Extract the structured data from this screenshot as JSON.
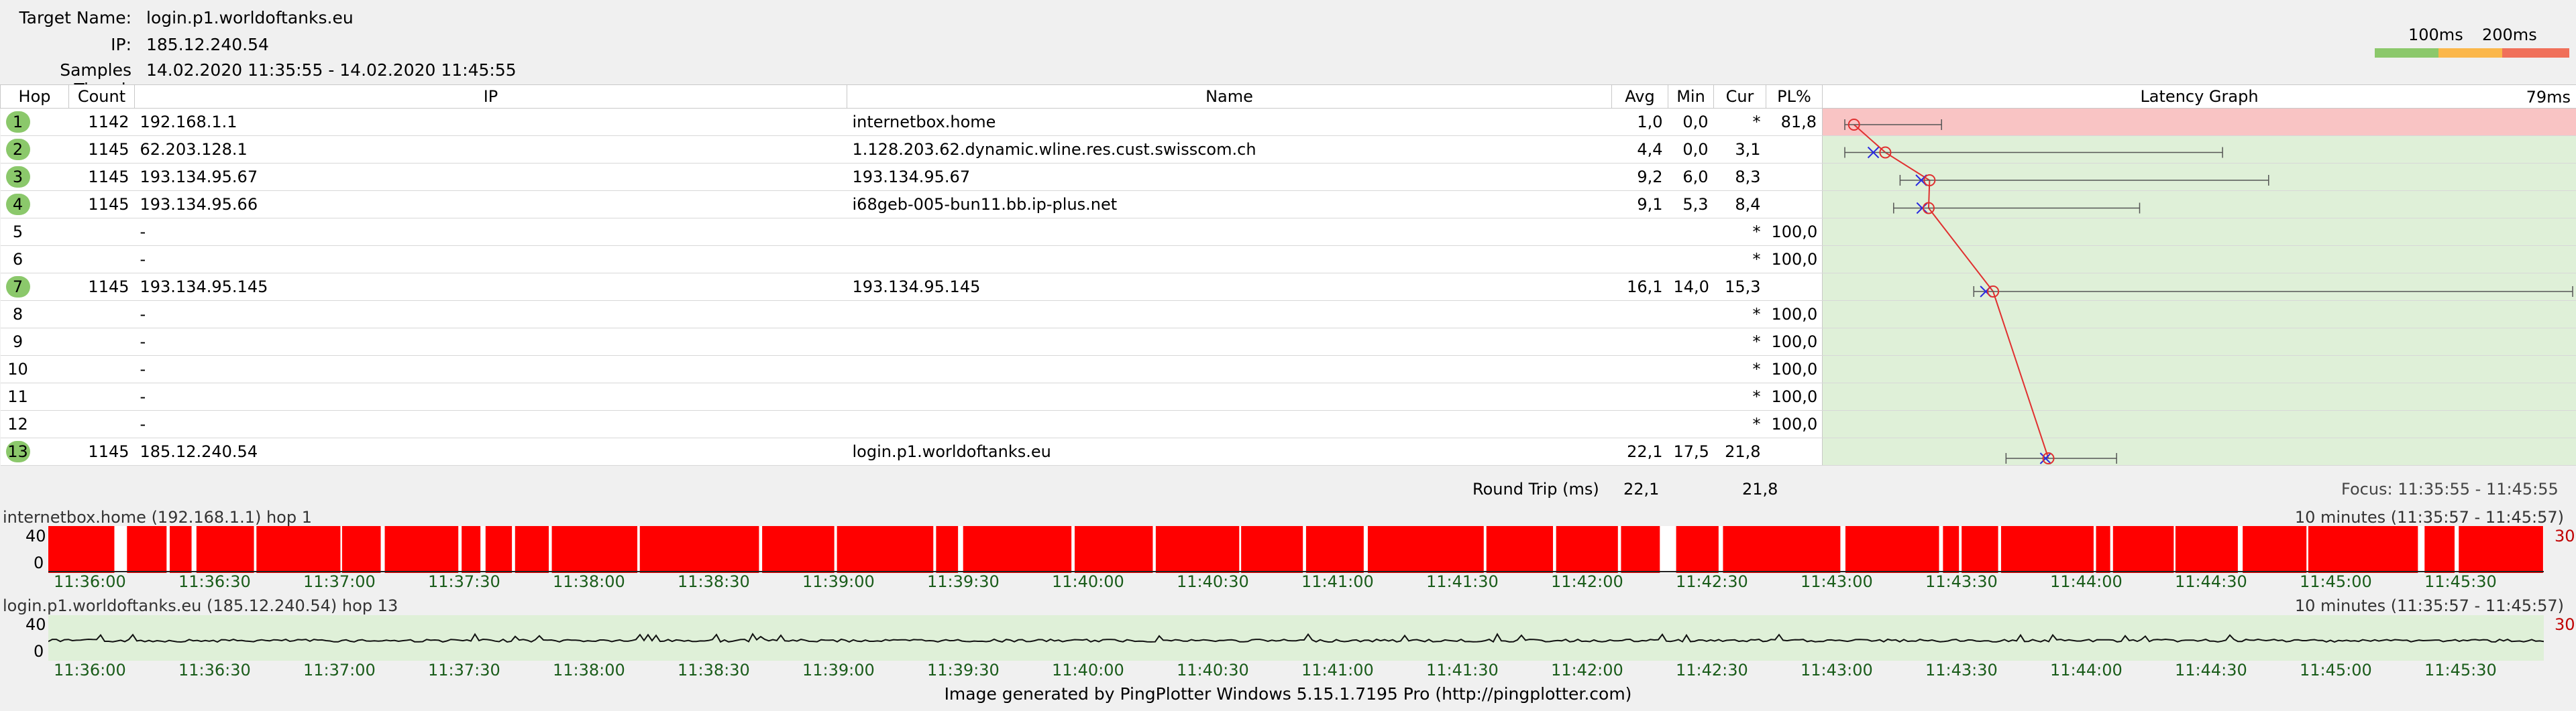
{
  "header": {
    "target_label": "Target Name:",
    "target_value": "login.p1.worldoftanks.eu",
    "ip_label": "IP:",
    "ip_value": "185.12.240.54",
    "samples_label": "Samples Timed:",
    "samples_value": "14.02.2020 11:35:55 - 14.02.2020 11:45:55"
  },
  "legend": {
    "label_100": "100ms",
    "label_200": "200ms",
    "colors": [
      "#8bc86b",
      "#fbb74a",
      "#f0705a"
    ]
  },
  "table": {
    "columns": [
      "Hop",
      "Count",
      "IP",
      "Name",
      "Avg",
      "Min",
      "Cur",
      "PL%",
      "Latency Graph"
    ],
    "graph_scale_label": "79ms",
    "rows": [
      {
        "hop": "1",
        "count": "1142",
        "ip": "192.168.1.1",
        "name": "internetbox.home",
        "avg": "1,0",
        "min": "0,0",
        "cur": "*",
        "pl": "81,8",
        "ok": true
      },
      {
        "hop": "2",
        "count": "1145",
        "ip": "62.203.128.1",
        "name": "1.128.203.62.dynamic.wline.res.cust.swisscom.ch",
        "avg": "4,4",
        "min": "0,0",
        "cur": "3,1",
        "pl": "",
        "ok": true
      },
      {
        "hop": "3",
        "count": "1145",
        "ip": "193.134.95.67",
        "name": "193.134.95.67",
        "avg": "9,2",
        "min": "6,0",
        "cur": "8,3",
        "pl": "",
        "ok": true
      },
      {
        "hop": "4",
        "count": "1145",
        "ip": "193.134.95.66",
        "name": "i68geb-005-bun11.bb.ip-plus.net",
        "avg": "9,1",
        "min": "5,3",
        "cur": "8,4",
        "pl": "",
        "ok": true
      },
      {
        "hop": "5",
        "count": "",
        "ip": "-",
        "name": "",
        "avg": "",
        "min": "",
        "cur": "*",
        "pl": "100,0",
        "ok": false
      },
      {
        "hop": "6",
        "count": "",
        "ip": "-",
        "name": "",
        "avg": "",
        "min": "",
        "cur": "*",
        "pl": "100,0",
        "ok": false
      },
      {
        "hop": "7",
        "count": "1145",
        "ip": "193.134.95.145",
        "name": "193.134.95.145",
        "avg": "16,1",
        "min": "14,0",
        "cur": "15,3",
        "pl": "",
        "ok": true
      },
      {
        "hop": "8",
        "count": "",
        "ip": "-",
        "name": "",
        "avg": "",
        "min": "",
        "cur": "*",
        "pl": "100,0",
        "ok": false
      },
      {
        "hop": "9",
        "count": "",
        "ip": "-",
        "name": "",
        "avg": "",
        "min": "",
        "cur": "*",
        "pl": "100,0",
        "ok": false
      },
      {
        "hop": "10",
        "count": "",
        "ip": "-",
        "name": "",
        "avg": "",
        "min": "",
        "cur": "*",
        "pl": "100,0",
        "ok": false
      },
      {
        "hop": "11",
        "count": "",
        "ip": "-",
        "name": "",
        "avg": "",
        "min": "",
        "cur": "*",
        "pl": "100,0",
        "ok": false
      },
      {
        "hop": "12",
        "count": "",
        "ip": "-",
        "name": "",
        "avg": "",
        "min": "",
        "cur": "*",
        "pl": "100,0",
        "ok": false
      },
      {
        "hop": "13",
        "count": "1145",
        "ip": "185.12.240.54",
        "name": "login.p1.worldoftanks.eu",
        "avg": "22,1",
        "min": "17,5",
        "cur": "21,8",
        "pl": "",
        "ok": true
      }
    ],
    "round_trip_label": "Round Trip (ms)",
    "round_trip_avg": "22,1",
    "round_trip_cur": "21,8",
    "focus_label": "Focus: 11:35:55 - 11:45:55"
  },
  "timeline1": {
    "title": "internetbox.home (192.168.1.1) hop 1",
    "range": "10 minutes (11:35:57 - 11:45:57)",
    "max_label": "30",
    "y_top": "40",
    "y_bottom": "0"
  },
  "timeline2": {
    "title": "login.p1.worldoftanks.eu (185.12.240.54) hop 13",
    "range": "10 minutes (11:35:57 - 11:45:57)",
    "max_label": "30",
    "y_top": "40",
    "y_bottom": "0"
  },
  "time_ticks": [
    "11:36:00",
    "11:36:30",
    "11:37:00",
    "11:37:30",
    "11:38:00",
    "11:38:30",
    "11:39:00",
    "11:39:30",
    "11:40:00",
    "11:40:30",
    "11:41:00",
    "11:41:30",
    "11:42:00",
    "11:42:30",
    "11:43:00",
    "11:43:30",
    "11:44:00",
    "11:44:30",
    "11:45:00",
    "11:45:30"
  ],
  "footer": "Image generated by PingPlotter Windows 5.15.1.7195 Pro (http://pingplotter.com)",
  "chart_data": {
    "type": "line",
    "title": "Latency Graph",
    "x_unit": "ms",
    "xlim": [
      0,
      79
    ],
    "hops": [
      {
        "hop": 1,
        "min": 0,
        "avg": 1.0,
        "cur": null,
        "max": 10.5
      },
      {
        "hop": 2,
        "min": 0,
        "avg": 4.4,
        "cur": 3.1,
        "max": 41
      },
      {
        "hop": 3,
        "min": 6.0,
        "avg": 9.2,
        "cur": 8.3,
        "max": 46
      },
      {
        "hop": 4,
        "min": 5.3,
        "avg": 9.1,
        "cur": 8.4,
        "max": 32
      },
      {
        "hop": 7,
        "min": 14.0,
        "avg": 16.1,
        "cur": 15.3,
        "max": 79
      },
      {
        "hop": 13,
        "min": 17.5,
        "avg": 22.1,
        "cur": 21.8,
        "max": 29.5
      }
    ]
  }
}
